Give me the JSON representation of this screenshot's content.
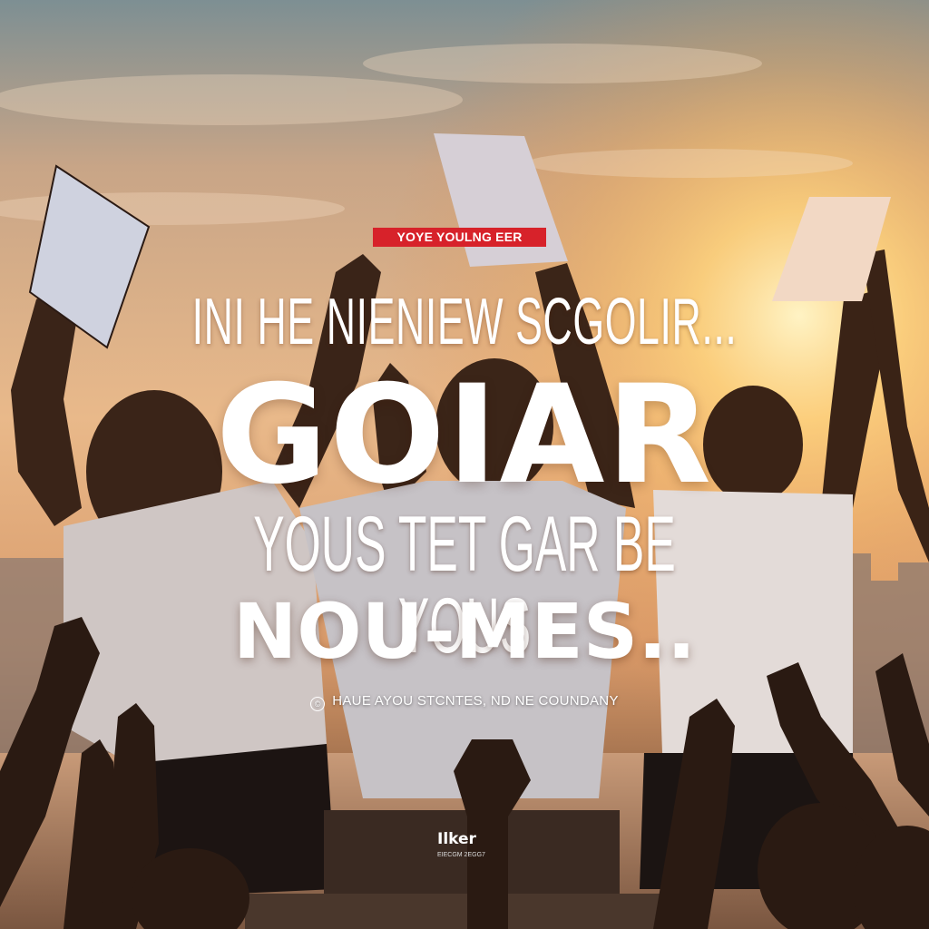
{
  "tag": "YOYE YOULNG EER",
  "line1": "INI HE NIENIEW SCGOLIR...",
  "headline": "GOIAR",
  "line3": "YOUS TET  GAR BE YOUS",
  "line4": "NOU-MES..",
  "small_text": "HAUE AYOU STCNTES, ND NE COUNDANY",
  "brand_name": "Ilker",
  "brand_sub": "EIECGM 2EGG7",
  "colors": {
    "tag_bg": "#d7222a",
    "sky_top": "#7d8f93",
    "sun": "#ffd27a"
  },
  "icons": {
    "small_text_icon": "copyright-circle-icon"
  }
}
